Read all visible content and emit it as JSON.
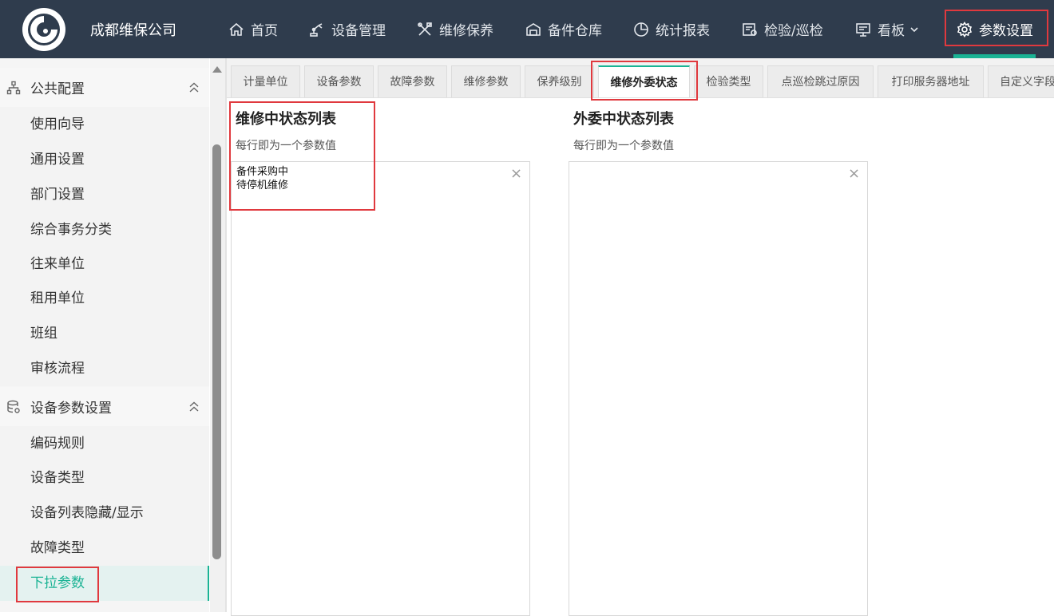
{
  "header": {
    "company": "成都维保公司",
    "nav": [
      {
        "label": "首页",
        "icon": "home-icon"
      },
      {
        "label": "设备管理",
        "icon": "robot-arm-icon"
      },
      {
        "label": "维修保养",
        "icon": "tools-icon"
      },
      {
        "label": "备件仓库",
        "icon": "warehouse-icon"
      },
      {
        "label": "统计报表",
        "icon": "pie-chart-icon"
      },
      {
        "label": "检验/巡检",
        "icon": "inspection-icon"
      },
      {
        "label": "看板",
        "icon": "board-icon"
      },
      {
        "label": "参数设置",
        "icon": "gear-icon"
      }
    ],
    "active_nav": "参数设置",
    "accent_color": "#1ab394",
    "bar_color": "#2f3c4d"
  },
  "sidebar": {
    "groups": [
      {
        "label": "公共配置",
        "icon": "sitemap-icon",
        "items": [
          "使用向导",
          "通用设置",
          "部门设置",
          "综合事务分类",
          "往来单位",
          "租用单位",
          "班组",
          "审核流程"
        ]
      },
      {
        "label": "设备参数设置",
        "icon": "database-gear-icon",
        "items": [
          "编码规则",
          "设备类型",
          "设备列表隐藏/显示",
          "故障类型",
          "下拉参数"
        ]
      }
    ],
    "active_item": "下拉参数"
  },
  "tabs": [
    "计量单位",
    "设备参数",
    "故障参数",
    "维修参数",
    "保养级别",
    "维修外委状态",
    "检验类型",
    "点巡检跳过原因",
    "打印服务器地址",
    "自定义字段"
  ],
  "active_tab": "维修外委状态",
  "main": {
    "repair_status": {
      "title": "维修中状态列表",
      "hint": "每行即为一个参数值",
      "value": "备件采购中\n待停机维修"
    },
    "outsource_status": {
      "title": "外委中状态列表",
      "hint": "每行即为一个参数值",
      "value": ""
    }
  }
}
